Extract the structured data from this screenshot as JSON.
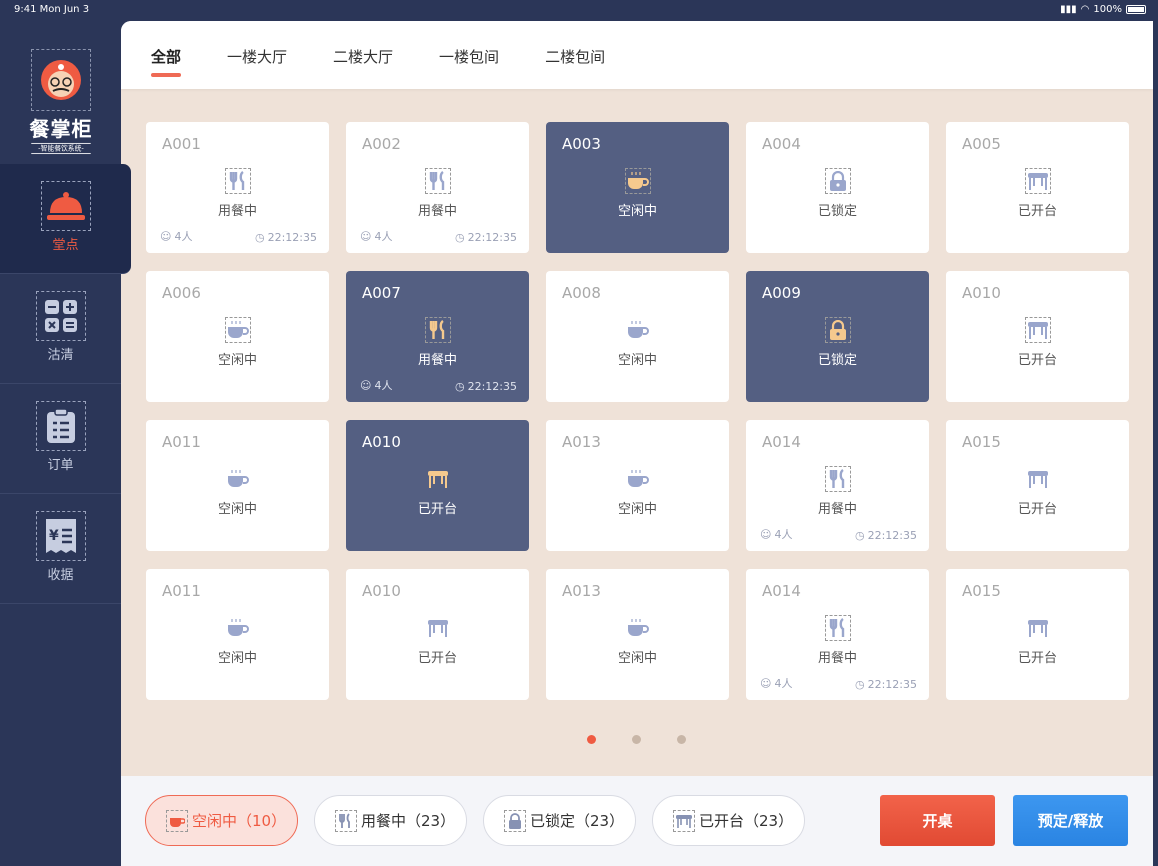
{
  "status_bar": {
    "time": "9:41  Mon Jun 3",
    "battery": "100%"
  },
  "logo": {
    "brand": "餐掌柜",
    "slogan": "-智能餐饮系统-"
  },
  "sidebar": {
    "items": [
      {
        "label": "堂点",
        "icon": "serving-dome-icon"
      },
      {
        "label": "沽清",
        "icon": "calculator-icon"
      },
      {
        "label": "订单",
        "icon": "clipboard-icon"
      },
      {
        "label": "收据",
        "icon": "receipt-icon"
      }
    ]
  },
  "tabs": [
    "全部",
    "一楼大厅",
    "二楼大厅",
    "一楼包间",
    "二楼包间"
  ],
  "tables": [
    {
      "code": "A001",
      "status": "用餐中",
      "type": "dining",
      "people": "4人",
      "time": "22:12:35",
      "dark": false
    },
    {
      "code": "A002",
      "status": "用餐中",
      "type": "dining",
      "people": "4人",
      "time": "22:12:35",
      "dark": false
    },
    {
      "code": "A003",
      "status": "空闲中",
      "type": "idle",
      "dark": true
    },
    {
      "code": "A004",
      "status": "已锁定",
      "type": "locked",
      "dark": false
    },
    {
      "code": "A005",
      "status": "已开台",
      "type": "opened",
      "dark": false
    },
    {
      "code": "A006",
      "status": "空闲中",
      "type": "idle",
      "dark": false
    },
    {
      "code": "A007",
      "status": "用餐中",
      "type": "dining",
      "people": "4人",
      "time": "22:12:35",
      "dark": true
    },
    {
      "code": "A008",
      "status": "空闲中",
      "type": "idle",
      "dark": false
    },
    {
      "code": "A009",
      "status": "已锁定",
      "type": "locked",
      "dark": true
    },
    {
      "code": "A010",
      "status": "已开台",
      "type": "opened",
      "dark": false
    },
    {
      "code": "A011",
      "status": "空闲中",
      "type": "idle",
      "dark": false
    },
    {
      "code": "A010",
      "status": "已开台",
      "type": "opened",
      "dark": true
    },
    {
      "code": "A013",
      "status": "空闲中",
      "type": "idle",
      "dark": false
    },
    {
      "code": "A014",
      "status": "用餐中",
      "type": "dining",
      "people": "4人",
      "time": "22:12:35",
      "dark": false
    },
    {
      "code": "A015",
      "status": "已开台",
      "type": "opened",
      "dark": false
    },
    {
      "code": "A011",
      "status": "空闲中",
      "type": "idle",
      "dark": false
    },
    {
      "code": "A010",
      "status": "已开台",
      "type": "opened",
      "dark": false
    },
    {
      "code": "A013",
      "status": "空闲中",
      "type": "idle",
      "dark": false
    },
    {
      "code": "A014",
      "status": "用餐中",
      "type": "dining",
      "people": "4人",
      "time": "22:12:35",
      "dark": false
    },
    {
      "code": "A015",
      "status": "已开台",
      "type": "opened",
      "dark": false
    }
  ],
  "pagination": {
    "pages": 3,
    "current": 1
  },
  "filters": [
    {
      "label": "空闲中（10）",
      "type": "idle",
      "active": true
    },
    {
      "label": "用餐中（23）",
      "type": "dining",
      "active": false
    },
    {
      "label": "已锁定（23）",
      "type": "locked",
      "active": false
    },
    {
      "label": "已开台（23）",
      "type": "opened",
      "active": false
    }
  ],
  "actions": {
    "open_table": "开桌",
    "reserve_release": "预定/释放"
  },
  "colors": {
    "accent": "#ef5b42",
    "dark_card": "#545f82",
    "sidebar": "#2b3658",
    "primary_blue": "#2a84e2"
  }
}
